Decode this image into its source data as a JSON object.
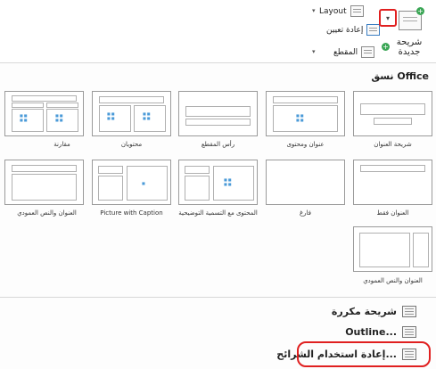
{
  "ribbon": {
    "layout_label": "Layout",
    "reset_label": "إعادة تعيين",
    "section_label": "المقطع",
    "new_slide_label": "شريحة جديدة",
    "plus_glyph": "+",
    "caret_glyph": "▾"
  },
  "gallery": {
    "section_title": "نسق Office",
    "layouts": [
      {
        "label": "شريحة العنوان"
      },
      {
        "label": "عنوان ومحتوى"
      },
      {
        "label": "رأس المقطع"
      },
      {
        "label": "محتويان"
      },
      {
        "label": "مقارنة"
      },
      {
        "label": "العنوان فقط"
      },
      {
        "label": "فارغ"
      },
      {
        "label": "المحتوى مع التسمية التوضيحية"
      },
      {
        "label": "Picture with Caption"
      },
      {
        "label": "العنوان والنص العمودي"
      },
      {
        "label": "العنوان والنص العمودي"
      }
    ]
  },
  "menu": {
    "duplicate_label": "شريحة مكررة",
    "outline_label": "Outline...",
    "reuse_label": "إعادة استخدام الشرائح..."
  },
  "colors": {
    "accent": "#e02020",
    "green": "#3aa655"
  }
}
